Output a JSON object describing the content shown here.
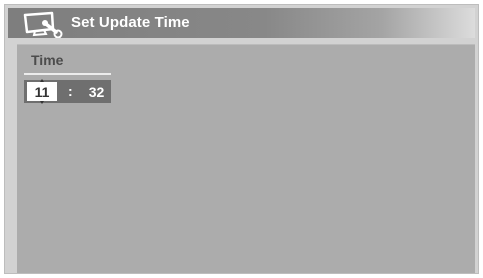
{
  "header": {
    "title": "Set Update Time",
    "icon": "setup-wrench-monitor-icon"
  },
  "section": {
    "label": "Time"
  },
  "time": {
    "hour": "11",
    "separator": ":",
    "minute": "32"
  },
  "colors": {
    "background": "#d2d2d2",
    "panel": "#acacac",
    "title_bar": "#888888",
    "selected_field": "#ffffff",
    "field_row": "#6f6f6f"
  }
}
